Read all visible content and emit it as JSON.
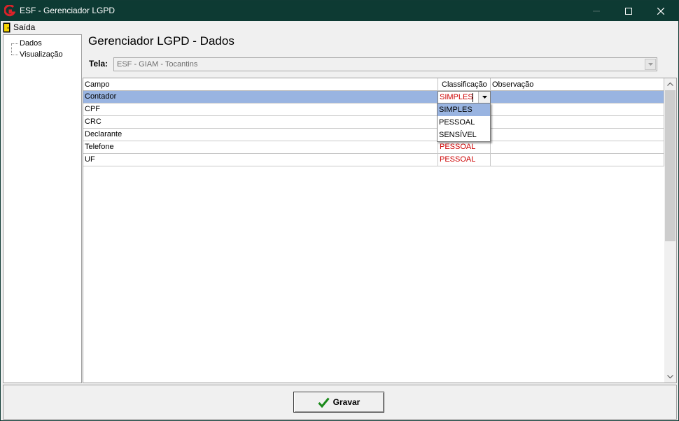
{
  "window": {
    "title": "ESF - Gerenciador LGPD"
  },
  "menu": {
    "exit_label": "Saída"
  },
  "tree": {
    "items": [
      {
        "label": "Dados"
      },
      {
        "label": "Visualização"
      }
    ]
  },
  "page": {
    "heading": "Gerenciador LGPD - Dados",
    "tela_label": "Tela:",
    "tela_value": "ESF - GIAM - Tocantins"
  },
  "grid": {
    "columns": [
      "Campo",
      "Classificação",
      "Observação"
    ],
    "rows": [
      {
        "campo": "Contador",
        "classificacao": "SIMPLES",
        "observacao": ""
      },
      {
        "campo": "CPF",
        "classificacao": "",
        "observacao": ""
      },
      {
        "campo": "CRC",
        "classificacao": "",
        "observacao": ""
      },
      {
        "campo": "Declarante",
        "classificacao": "",
        "observacao": ""
      },
      {
        "campo": "Telefone",
        "classificacao": "PESSOAL",
        "observacao": ""
      },
      {
        "campo": "UF",
        "classificacao": "PESSOAL",
        "observacao": ""
      }
    ],
    "selected_row": 0
  },
  "dropdown": {
    "options": [
      "SIMPLES",
      "PESSOAL",
      "SENSÍVEL"
    ],
    "highlighted": 0
  },
  "footer": {
    "save_label": "Gravar"
  },
  "colors": {
    "titlebar": "#0d3a33",
    "selection": "#99b4e1",
    "classification_text": "#cc0000"
  }
}
